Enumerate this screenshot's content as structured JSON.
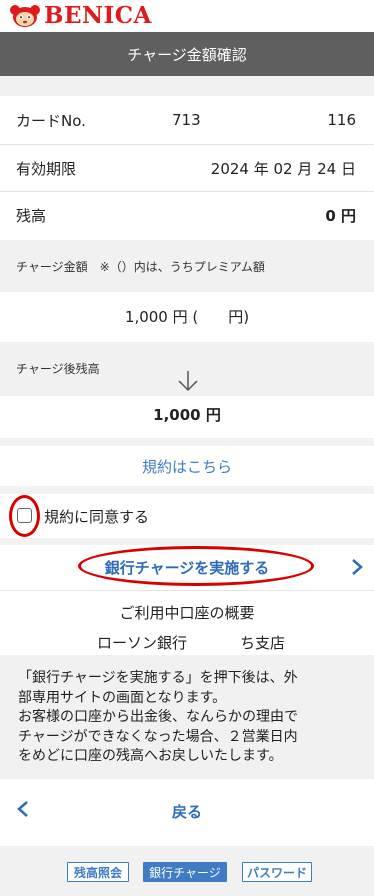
{
  "header": {
    "brand": "BENICA",
    "title": "チャージ金額確認"
  },
  "card": {
    "card_no_label": "カードNo.",
    "card_no_part1": "713",
    "card_no_part2": "116",
    "expiry_label": "有効期限",
    "expiry_value": "2024 年 02 月 24 日",
    "balance_label": "残高",
    "balance_value": "0 円"
  },
  "charge": {
    "section_label": "チャージ金額　※（）内は、うちプレミアム額",
    "amount_value": "1,000 円 (　　円)"
  },
  "after": {
    "section_label": "チャージ後残高",
    "amount_value": "1,000 円"
  },
  "terms": {
    "link_label": "規約はこちら",
    "agree_label": "規約に同意する",
    "agree_checked": false
  },
  "bank_charge_button": "銀行チャージを実施する",
  "account": {
    "title": "ご利用中口座の概要",
    "bank_name": "ローソン銀行",
    "branch_name": "ち支店"
  },
  "notice": {
    "line1": "「銀行チャージを実施する」を押下後は、外",
    "line2": "部専用サイトの画面となります。",
    "line3": "お客様の口座から出金後、なんらかの理由で",
    "line4": "チャージができなくなった場合、２営業日内",
    "line5": "をめどに口座の残高へお戻しいたします。"
  },
  "back_button": "戻る",
  "footer_tabs": [
    {
      "label": "残高照会",
      "active": false
    },
    {
      "label": "銀行チャージ",
      "active": true
    },
    {
      "label": "パスワード",
      "active": false
    }
  ],
  "colors": {
    "brand_red": "#e01a1a",
    "link_blue": "#2e6cb8",
    "titlebar": "#5f5f5f",
    "annotation_red": "#d90000"
  }
}
